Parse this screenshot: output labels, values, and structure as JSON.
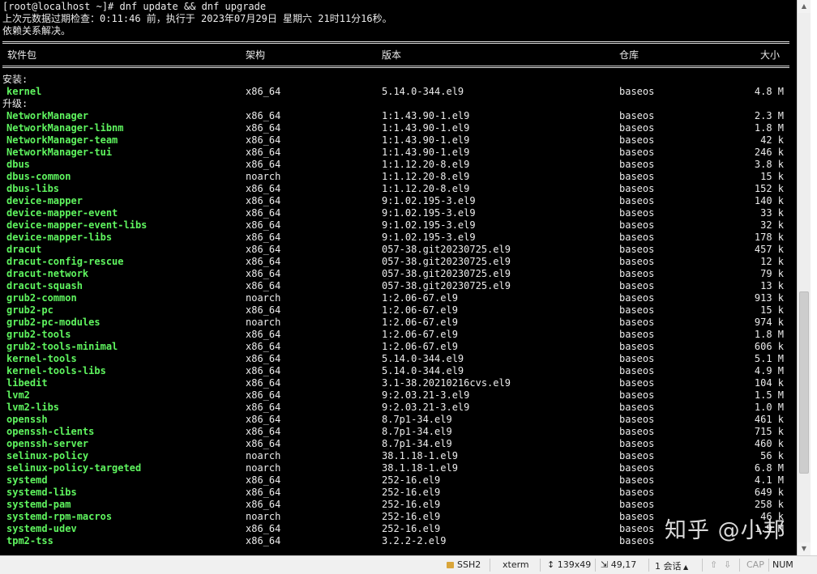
{
  "terminal": {
    "prompt_line": "[root@localhost ~]# dnf update && dnf upgrade",
    "metadata_line": "上次元数据过期检查：0:11:46 前，执行于 2023年07月29日 星期六 21时11分16秒。",
    "deps_line": "依赖关系解决。",
    "headers": {
      "package": "软件包",
      "arch": "架构",
      "version": "版本",
      "repo": "仓库",
      "size": "大小"
    },
    "install_label": "安装:",
    "install": [
      {
        "name": "kernel",
        "arch": "x86_64",
        "version": "5.14.0-344.el9",
        "repo": "baseos",
        "size": "4.8 M"
      }
    ],
    "upgrade_label": "升级:",
    "upgrade": [
      {
        "name": "NetworkManager",
        "arch": "x86_64",
        "version": "1:1.43.90-1.el9",
        "repo": "baseos",
        "size": "2.3 M"
      },
      {
        "name": "NetworkManager-libnm",
        "arch": "x86_64",
        "version": "1:1.43.90-1.el9",
        "repo": "baseos",
        "size": "1.8 M"
      },
      {
        "name": "NetworkManager-team",
        "arch": "x86_64",
        "version": "1:1.43.90-1.el9",
        "repo": "baseos",
        "size": "42 k"
      },
      {
        "name": "NetworkManager-tui",
        "arch": "x86_64",
        "version": "1:1.43.90-1.el9",
        "repo": "baseos",
        "size": "246 k"
      },
      {
        "name": "dbus",
        "arch": "x86_64",
        "version": "1:1.12.20-8.el9",
        "repo": "baseos",
        "size": "3.8 k"
      },
      {
        "name": "dbus-common",
        "arch": "noarch",
        "version": "1:1.12.20-8.el9",
        "repo": "baseos",
        "size": "15 k"
      },
      {
        "name": "dbus-libs",
        "arch": "x86_64",
        "version": "1:1.12.20-8.el9",
        "repo": "baseos",
        "size": "152 k"
      },
      {
        "name": "device-mapper",
        "arch": "x86_64",
        "version": "9:1.02.195-3.el9",
        "repo": "baseos",
        "size": "140 k"
      },
      {
        "name": "device-mapper-event",
        "arch": "x86_64",
        "version": "9:1.02.195-3.el9",
        "repo": "baseos",
        "size": "33 k"
      },
      {
        "name": "device-mapper-event-libs",
        "arch": "x86_64",
        "version": "9:1.02.195-3.el9",
        "repo": "baseos",
        "size": "32 k"
      },
      {
        "name": "device-mapper-libs",
        "arch": "x86_64",
        "version": "9:1.02.195-3.el9",
        "repo": "baseos",
        "size": "178 k"
      },
      {
        "name": "dracut",
        "arch": "x86_64",
        "version": "057-38.git20230725.el9",
        "repo": "baseos",
        "size": "457 k"
      },
      {
        "name": "dracut-config-rescue",
        "arch": "x86_64",
        "version": "057-38.git20230725.el9",
        "repo": "baseos",
        "size": "12 k"
      },
      {
        "name": "dracut-network",
        "arch": "x86_64",
        "version": "057-38.git20230725.el9",
        "repo": "baseos",
        "size": "79 k"
      },
      {
        "name": "dracut-squash",
        "arch": "x86_64",
        "version": "057-38.git20230725.el9",
        "repo": "baseos",
        "size": "13 k"
      },
      {
        "name": "grub2-common",
        "arch": "noarch",
        "version": "1:2.06-67.el9",
        "repo": "baseos",
        "size": "913 k"
      },
      {
        "name": "grub2-pc",
        "arch": "x86_64",
        "version": "1:2.06-67.el9",
        "repo": "baseos",
        "size": "15 k"
      },
      {
        "name": "grub2-pc-modules",
        "arch": "noarch",
        "version": "1:2.06-67.el9",
        "repo": "baseos",
        "size": "974 k"
      },
      {
        "name": "grub2-tools",
        "arch": "x86_64",
        "version": "1:2.06-67.el9",
        "repo": "baseos",
        "size": "1.8 M"
      },
      {
        "name": "grub2-tools-minimal",
        "arch": "x86_64",
        "version": "1:2.06-67.el9",
        "repo": "baseos",
        "size": "606 k"
      },
      {
        "name": "kernel-tools",
        "arch": "x86_64",
        "version": "5.14.0-344.el9",
        "repo": "baseos",
        "size": "5.1 M"
      },
      {
        "name": "kernel-tools-libs",
        "arch": "x86_64",
        "version": "5.14.0-344.el9",
        "repo": "baseos",
        "size": "4.9 M"
      },
      {
        "name": "libedit",
        "arch": "x86_64",
        "version": "3.1-38.20210216cvs.el9",
        "repo": "baseos",
        "size": "104 k"
      },
      {
        "name": "lvm2",
        "arch": "x86_64",
        "version": "9:2.03.21-3.el9",
        "repo": "baseos",
        "size": "1.5 M"
      },
      {
        "name": "lvm2-libs",
        "arch": "x86_64",
        "version": "9:2.03.21-3.el9",
        "repo": "baseos",
        "size": "1.0 M"
      },
      {
        "name": "openssh",
        "arch": "x86_64",
        "version": "8.7p1-34.el9",
        "repo": "baseos",
        "size": "461 k"
      },
      {
        "name": "openssh-clients",
        "arch": "x86_64",
        "version": "8.7p1-34.el9",
        "repo": "baseos",
        "size": "715 k"
      },
      {
        "name": "openssh-server",
        "arch": "x86_64",
        "version": "8.7p1-34.el9",
        "repo": "baseos",
        "size": "460 k"
      },
      {
        "name": "selinux-policy",
        "arch": "noarch",
        "version": "38.1.18-1.el9",
        "repo": "baseos",
        "size": "56 k"
      },
      {
        "name": "selinux-policy-targeted",
        "arch": "noarch",
        "version": "38.1.18-1.el9",
        "repo": "baseos",
        "size": "6.8 M"
      },
      {
        "name": "systemd",
        "arch": "x86_64",
        "version": "252-16.el9",
        "repo": "baseos",
        "size": "4.1 M"
      },
      {
        "name": "systemd-libs",
        "arch": "x86_64",
        "version": "252-16.el9",
        "repo": "baseos",
        "size": "649 k"
      },
      {
        "name": "systemd-pam",
        "arch": "x86_64",
        "version": "252-16.el9",
        "repo": "baseos",
        "size": "258 k"
      },
      {
        "name": "systemd-rpm-macros",
        "arch": "noarch",
        "version": "252-16.el9",
        "repo": "baseos",
        "size": "46 k"
      },
      {
        "name": "systemd-udev",
        "arch": "x86_64",
        "version": "252-16.el9",
        "repo": "baseos",
        "size": "1.9 M"
      },
      {
        "name": "tpm2-tss",
        "arch": "x86_64",
        "version": "3.2.2-2.el9",
        "repo": "baseos",
        "size": ""
      }
    ]
  },
  "statusbar": {
    "protocol": "SSH2",
    "terminal_type": "xterm",
    "dimensions": "139x49",
    "cursor": "49,17",
    "sessions": "1 会话",
    "caps": "CAP",
    "num": "NUM"
  },
  "watermark": "知乎 @小邦",
  "colors": {
    "package_name": "#5ff55f",
    "terminal_bg": "#000000",
    "terminal_fg": "#ececec"
  },
  "icons": {
    "lock": "lock-icon",
    "resize": "resize-icon",
    "cursor": "cursor-position-icon",
    "up": "arrow-up-icon",
    "down": "arrow-down-icon"
  }
}
